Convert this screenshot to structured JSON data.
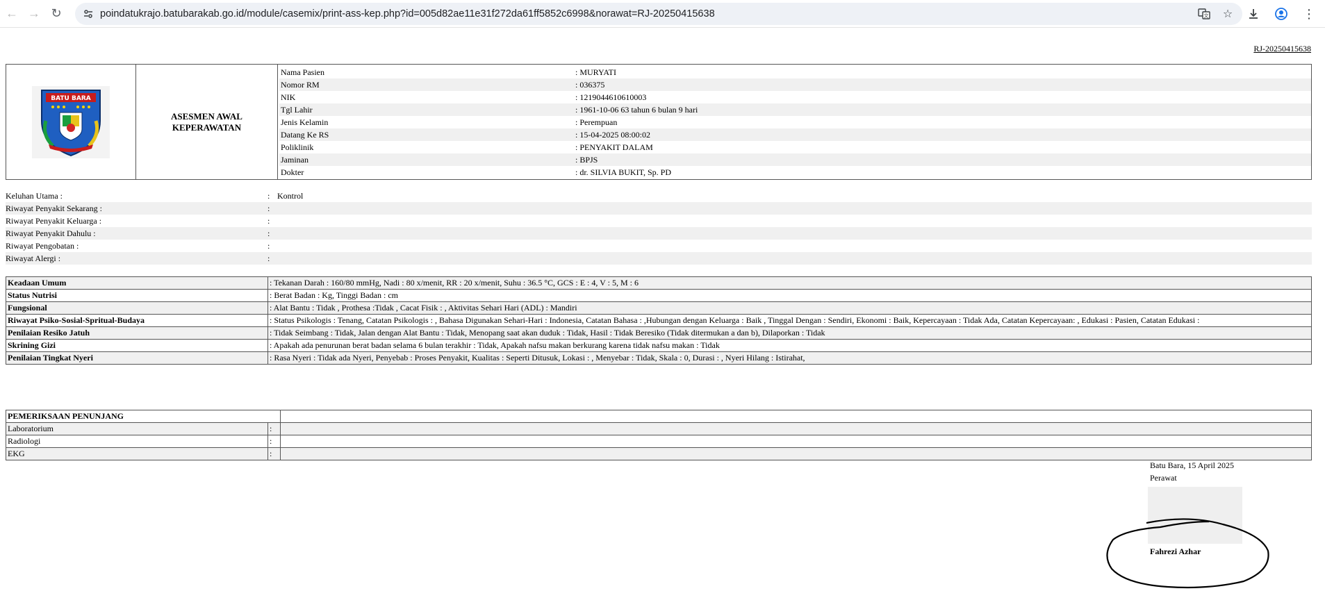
{
  "browser": {
    "url": "poindatukrajo.batubarakab.go.id/module/casemix/print-ass-kep.php?id=005d82ae11e31f272da61ff5852c6998&norawat=RJ-20250415638"
  },
  "document": {
    "norawat": "RJ-20250415638",
    "logo_text": "BATU BARA",
    "title_line1": "ASESMEN AWAL",
    "title_line2": "KEPERAWATAN",
    "patient": [
      {
        "label": "Nama Pasien",
        "value": ": MURYATI"
      },
      {
        "label": "Nomor RM",
        "value": ": 036375"
      },
      {
        "label": "NIK",
        "value": ": 1219044610610003"
      },
      {
        "label": "Tgl Lahir",
        "value": ": 1961-10-06 63 tahun 6 bulan 9 hari"
      },
      {
        "label": "Jenis Kelamin",
        "value": ": Perempuan"
      },
      {
        "label": "Datang Ke RS",
        "value": ": 15-04-2025 08:00:02"
      },
      {
        "label": "Poliklinik",
        "value": ": PENYAKIT DALAM"
      },
      {
        "label": "Jaminan",
        "value": ": BPJS"
      },
      {
        "label": "Dokter",
        "value": ": dr. SILVIA BUKIT, Sp. PD"
      }
    ],
    "keluhan": [
      {
        "label": "Keluhan Utama :",
        "colon": ":",
        "value": "Kontrol"
      },
      {
        "label": "Riwayat Penyakit Sekarang :",
        "colon": ":",
        "value": ""
      },
      {
        "label": "Riwayat Penyakit Keluarga :",
        "colon": ":",
        "value": ""
      },
      {
        "label": "Riwayat Penyakit Dahulu :",
        "colon": ":",
        "value": ""
      },
      {
        "label": "Riwayat Pengobatan :",
        "colon": ":",
        "value": ""
      },
      {
        "label": "Riwayat Alergi :",
        "colon": ":",
        "value": ""
      }
    ],
    "status": [
      {
        "label": "Keadaan Umum",
        "value": ": Tekanan Darah : 160/80 mmHg, Nadi : 80 x/menit, RR : 20 x/menit, Suhu : 36.5 °C, GCS : E : 4, V : 5, M : 6"
      },
      {
        "label": "Status Nutrisi",
        "value": ": Berat Badan : Kg, Tinggi Badan : cm"
      },
      {
        "label": "Fungsional",
        "value": ": Alat Bantu : Tidak , Prothesa :Tidak , Cacat Fisik : , Aktivitas Sehari Hari (ADL) : Mandiri"
      },
      {
        "label": "Riwayat Psiko-Sosial-Spritual-Budaya",
        "value": ": Status Psikologis : Tenang, Catatan Psikologis : , Bahasa Digunakan Sehari-Hari : Indonesia, Catatan Bahasa : ,Hubungan dengan Keluarga : Baik , Tinggal Dengan : Sendiri, Ekonomi : Baik, Kepercayaan : Tidak Ada, Catatan Kepercayaan: , Edukasi : Pasien, Catatan Edukasi :"
      },
      {
        "label": "Penilaian Resiko Jatuh",
        "value": ": Tidak Seimbang : Tidak, Jalan dengan Alat Bantu : Tidak, Menopang saat akan duduk : Tidak, Hasil : Tidak Beresiko (Tidak ditermukan a dan b), Dilaporkan : Tidak"
      },
      {
        "label": "Skrining Gizi",
        "value": ": Apakah ada penurunan berat badan selama 6 bulan terakhir : Tidak, Apakah nafsu makan berkurang karena tidak nafsu makan : Tidak"
      },
      {
        "label": "Penilaian Tingkat Nyeri",
        "value": ": Rasa Nyeri : Tidak ada Nyeri, Penyebab : Proses Penyakit, Kualitas : Seperti Ditusuk, Lokasi : , Menyebar : Tidak, Skala : 0, Durasi : , Nyeri Hilang : Istirahat,"
      }
    ],
    "penunjang_title": "PEMERIKSAAN PENUNJANG",
    "penunjang": [
      {
        "label": "Laboratorium",
        "colon": ":",
        "value": ""
      },
      {
        "label": "Radiologi",
        "colon": ":",
        "value": ""
      },
      {
        "label": "EKG",
        "colon": ":",
        "value": ""
      }
    ],
    "signature": {
      "place_date": "Batu Bara, 15 April 2025",
      "role": "Perawat",
      "name": "Fahrezi Azhar"
    }
  }
}
